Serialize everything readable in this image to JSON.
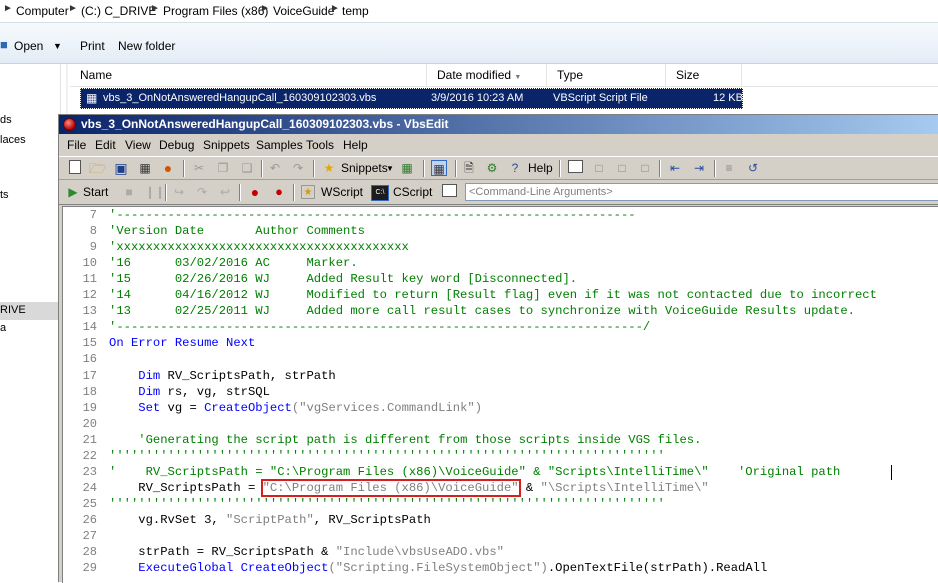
{
  "explorer": {
    "breadcrumb": [
      "Computer",
      "(C:) C_DRIVE",
      "Program Files (x86)",
      "VoiceGuide",
      "temp"
    ],
    "toolbar": {
      "open": "Open",
      "print": "Print",
      "new_folder": "New folder"
    },
    "nav": {
      "item1": "ds",
      "item2": "laces",
      "item3": "ts",
      "item4": "RIVE",
      "item5": "a"
    },
    "columns": {
      "name": "Name",
      "date": "Date modified",
      "type": "Type",
      "size": "Size"
    },
    "file": {
      "name": "vbs_3_OnNotAnsweredHangupCall_160309102303.vbs",
      "date": "3/9/2016 10:23 AM",
      "type": "VBScript Script File",
      "size": "12 KB"
    }
  },
  "vbsedit": {
    "title": "vbs_3_OnNotAnsweredHangupCall_160309102303.vbs - VbsEdit",
    "menu": [
      "File",
      "Edit",
      "View",
      "Debug",
      "Snippets",
      "Samples",
      "Tools",
      "Help"
    ],
    "toolbar": {
      "snippets": "Snippets",
      "help": "Help",
      "start": "Start",
      "wscript": "WScript",
      "cscript": "CScript"
    },
    "cmdargs_placeholder": "<Command-Line Arguments>",
    "code_lines": [
      {
        "n": "7",
        "text": "'-----------------------------------------------------------------------"
      },
      {
        "n": "8",
        "text": "'Version Date       Author Comments"
      },
      {
        "n": "9",
        "text": "'xxxxxxxxxxxxxxxxxxxxxxxxxxxxxxxxxxxxxxxx"
      },
      {
        "n": "10",
        "text": "'16      03/02/2016 AC     Marker."
      },
      {
        "n": "11",
        "text": "'15      02/26/2016 WJ     Added Result key word [Disconnected]."
      },
      {
        "n": "12",
        "text": "'14      04/16/2012 WJ     Modified to return [Result flag] even if it was not contacted due to incorrect"
      },
      {
        "n": "13",
        "text": "'13      02/25/2011 WJ     Added more call result cases to synchronize with VoiceGuide Results update."
      },
      {
        "n": "14",
        "text": "'------------------------------------------------------------------------/"
      },
      {
        "n": "15",
        "kw1": "On Error Resume Next"
      },
      {
        "n": "16"
      },
      {
        "n": "17",
        "kw1": "Dim",
        "rest": " RV_ScriptsPath, strPath"
      },
      {
        "n": "18",
        "kw1": "Dim",
        "rest": " rs, vg, strSQL"
      },
      {
        "n": "19",
        "kw1": "Set",
        "rest": " vg = ",
        "kw2": "CreateObject",
        "s1": "(\"vgServices.CommandLink\")"
      },
      {
        "n": "20"
      },
      {
        "n": "21",
        "cm": "'Generating the script path is different from those scripts inside VGS files."
      },
      {
        "n": "22",
        "cm": "''''''''''''''''''''''''''''''''''''''''''''''''''''''''''''''''''''''''''''"
      },
      {
        "n": "23",
        "cm": "'    RV_ScriptsPath = \"C:\\Program Files (x86)\\VoiceGuide\" & \"Scripts\\IntelliTime\\\"    'Original path"
      },
      {
        "n": "24",
        "pre": "    RV_ScriptsPath = ",
        "hl": "\"C:\\Program Files (x86)\\VoiceGuide\"",
        "post1": " & ",
        "post2": "\"\\Scripts\\IntelliTime\\\""
      },
      {
        "n": "25",
        "cm": "''''''''''''''''''''''''''''''''''''''''''''''''''''''''''''''''''''''''''''"
      },
      {
        "n": "26",
        "pre": "    vg.RvSet 3, ",
        "s1": "\"ScriptPath\"",
        "post1": ", RV_ScriptsPath"
      },
      {
        "n": "27"
      },
      {
        "n": "28",
        "pre": "    strPath = RV_ScriptsPath & ",
        "s1": "\"Include\\vbsUseADO.vbs\""
      },
      {
        "n": "29",
        "kw1": "ExecuteGlobal",
        "mid": " ",
        "kw2": "CreateObject",
        "s1": "(\"Scripting.FileSystemObject\")",
        "post1": ".OpenTextFile(strPath).ReadAll"
      }
    ]
  }
}
